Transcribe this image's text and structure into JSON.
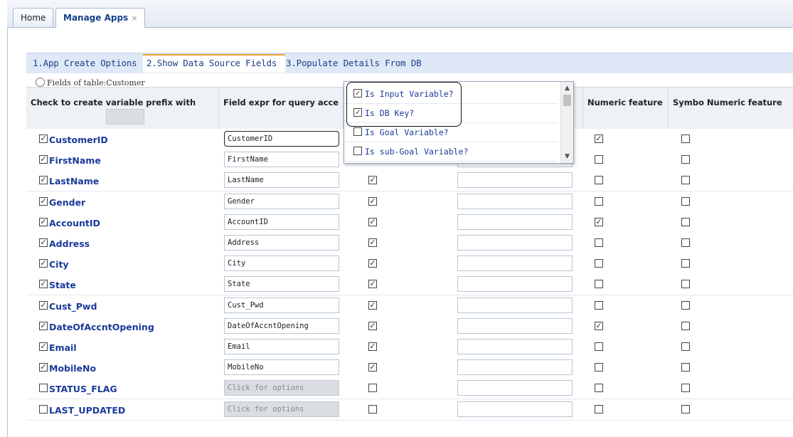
{
  "tabs": {
    "home": "Home",
    "manage": "Manage Apps",
    "close": "×"
  },
  "wizard": {
    "step1": "1.App Create Options",
    "step2": "2.Show Data Source Fields",
    "step3": "3.Populate Details From DB"
  },
  "fields_caption": "Fields of table:Customer",
  "columns": {
    "prefix": "Check to create variable prefix with",
    "expr": "Field expr for query acce",
    "numeric": "Numeric feature",
    "symbo": "Symbo Numeric feature"
  },
  "rows": [
    {
      "name": "CustomerID",
      "checked": true,
      "expr": "CustomerID",
      "disabled": false,
      "col3": true,
      "numeric": true,
      "symbo": false
    },
    {
      "name": "FirstName",
      "checked": true,
      "expr": "FirstName",
      "disabled": false,
      "col3": true,
      "numeric": false,
      "symbo": false
    },
    {
      "name": "LastName",
      "checked": true,
      "expr": "LastName",
      "disabled": false,
      "col3": true,
      "numeric": false,
      "symbo": false
    },
    {
      "name": "Gender",
      "checked": true,
      "expr": "Gender",
      "disabled": false,
      "col3": true,
      "numeric": false,
      "symbo": false
    },
    {
      "name": "AccountID",
      "checked": true,
      "expr": "AccountID",
      "disabled": false,
      "col3": true,
      "numeric": true,
      "symbo": false
    },
    {
      "name": "Address",
      "checked": true,
      "expr": "Address",
      "disabled": false,
      "col3": true,
      "numeric": false,
      "symbo": false
    },
    {
      "name": "City",
      "checked": true,
      "expr": "City",
      "disabled": false,
      "col3": true,
      "numeric": false,
      "symbo": false
    },
    {
      "name": "State",
      "checked": true,
      "expr": "State",
      "disabled": false,
      "col3": true,
      "numeric": false,
      "symbo": false
    },
    {
      "name": "Cust_Pwd",
      "checked": true,
      "expr": "Cust_Pwd",
      "disabled": false,
      "col3": true,
      "numeric": false,
      "symbo": false
    },
    {
      "name": "DateOfAccntOpening",
      "checked": true,
      "expr": "DateOfAccntOpening",
      "disabled": false,
      "col3": true,
      "numeric": true,
      "symbo": false
    },
    {
      "name": "Email",
      "checked": true,
      "expr": "Email",
      "disabled": false,
      "col3": true,
      "numeric": false,
      "symbo": false
    },
    {
      "name": "MobileNo",
      "checked": true,
      "expr": "MobileNo",
      "disabled": false,
      "col3": true,
      "numeric": false,
      "symbo": false
    },
    {
      "name": "STATUS_FLAG",
      "checked": false,
      "expr": "Click for options",
      "disabled": true,
      "col3": false,
      "numeric": false,
      "symbo": false
    },
    {
      "name": "LAST_UPDATED",
      "checked": false,
      "expr": "Click for options",
      "disabled": true,
      "col3": false,
      "numeric": false,
      "symbo": false
    }
  ],
  "dropdown": {
    "items": [
      {
        "label": "Is Input Variable?",
        "checked": true
      },
      {
        "label": "Is DB Key?",
        "checked": true
      },
      {
        "label": "Is Goal Variable?",
        "checked": false
      },
      {
        "label": "Is sub-Goal Variable?",
        "checked": false
      }
    ]
  },
  "check_mark": "✓"
}
